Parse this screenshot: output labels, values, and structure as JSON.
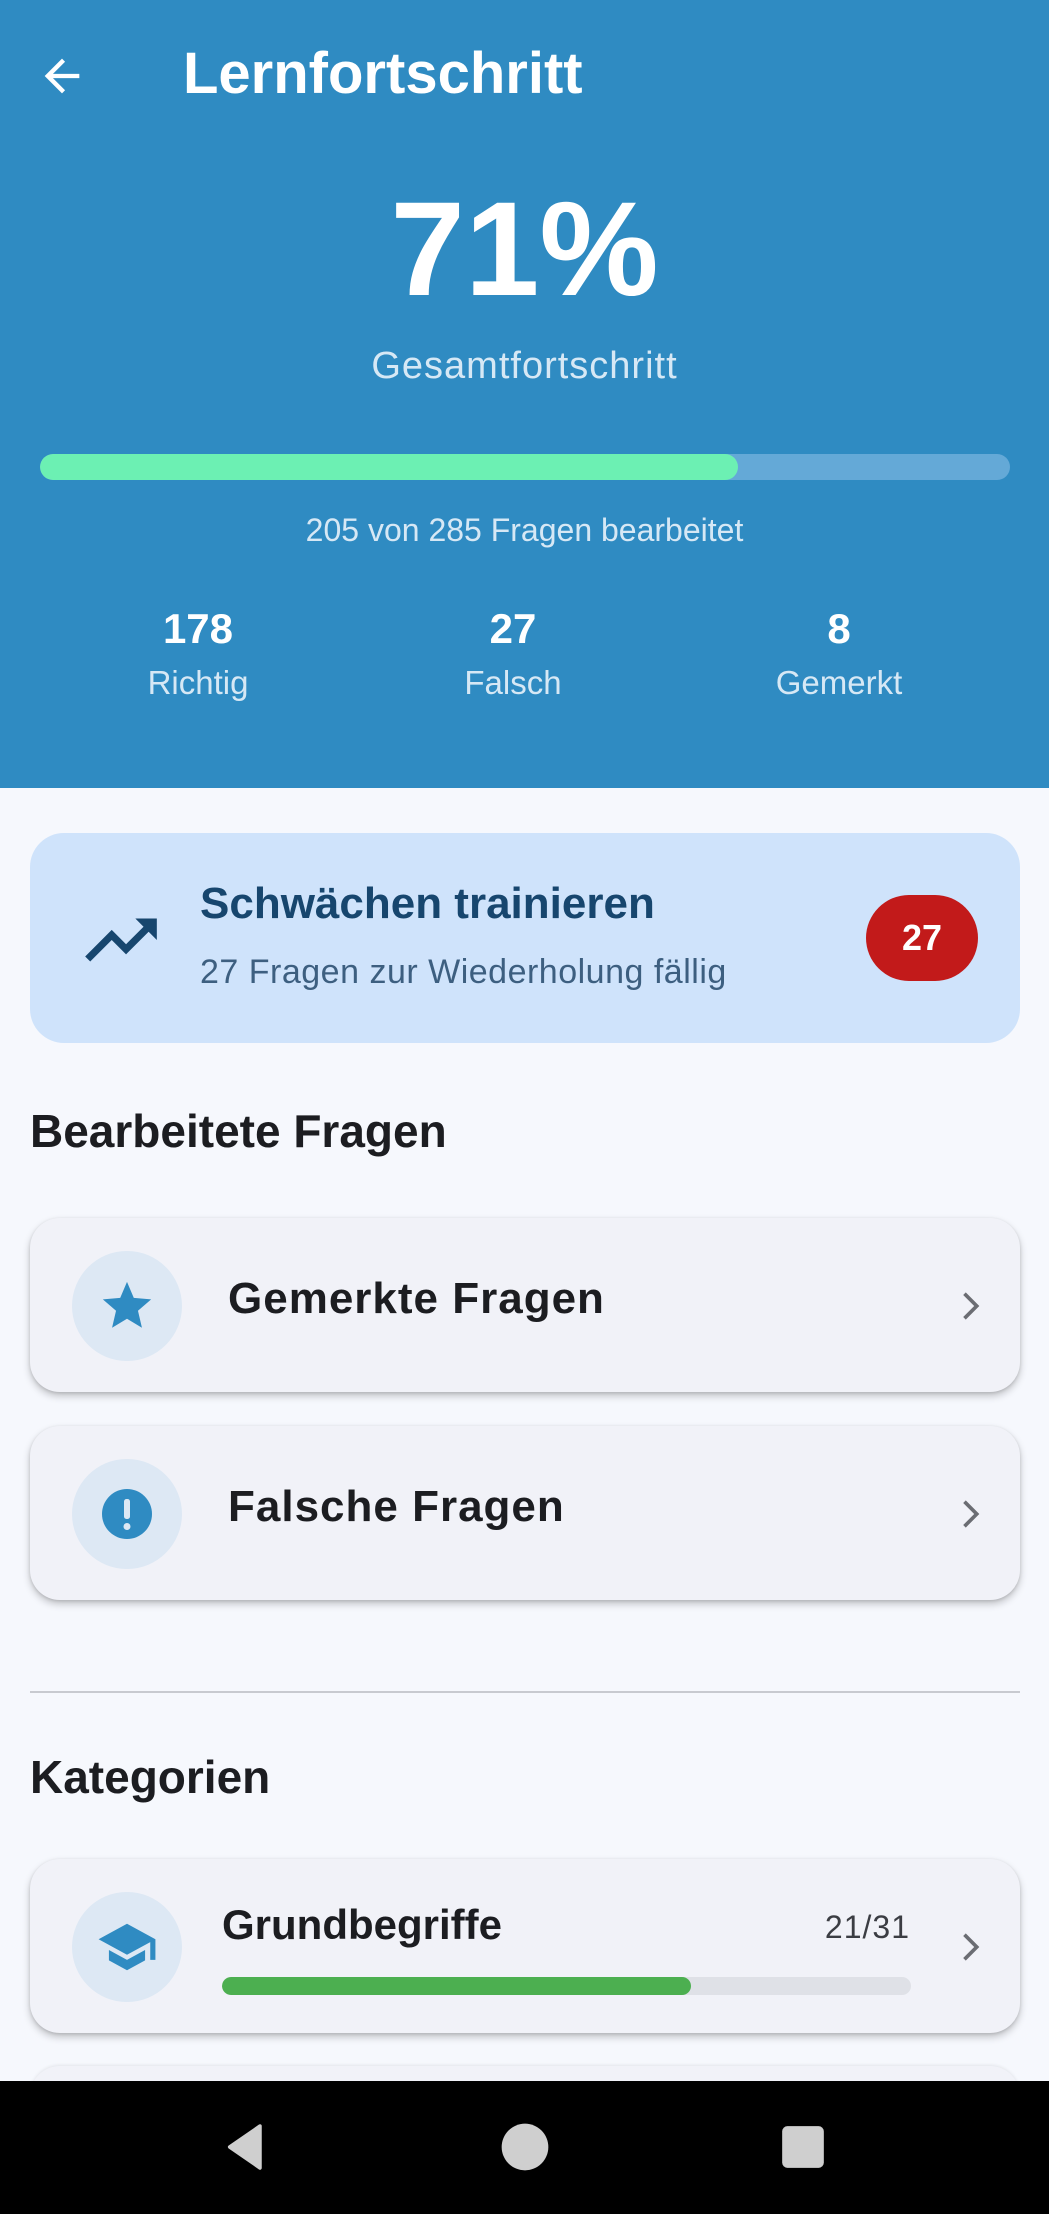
{
  "header": {
    "title": "Lernfortschritt",
    "percent": "71%",
    "overall_label": "Gesamtfortschritt",
    "progress_fraction": 0.72,
    "progress_caption": "205 von 285 Fragen bearbeitet",
    "stats": [
      {
        "value": "178",
        "label": "Richtig"
      },
      {
        "value": "27",
        "label": "Falsch"
      },
      {
        "value": "8",
        "label": "Gemerkt"
      }
    ]
  },
  "weak_training": {
    "icon": "trending-up-icon",
    "title": "Schwächen trainieren",
    "subtitle": "27 Fragen zur Wiederholung fällig",
    "badge": "27"
  },
  "answered_section": {
    "title": "Bearbeitete Fragen",
    "items": [
      {
        "icon": "star-icon",
        "label": "Gemerkte Fragen"
      },
      {
        "icon": "exclamation-icon",
        "label": "Falsche Fragen"
      }
    ]
  },
  "categories_section": {
    "title": "Kategorien",
    "items": [
      {
        "icon": "graduation-cap-icon",
        "name": "Grundbegriffe",
        "count": "21/31",
        "progress_fraction": 0.68
      }
    ]
  },
  "colors": {
    "header_bg": "#2f8bc2",
    "progress_fill": "#6cf0b3",
    "badge_red": "#c21a1a",
    "category_fill": "#4caf50",
    "weak_card_bg": "#cfe3fb"
  },
  "navbar": {
    "icons": [
      "back-triangle-icon",
      "home-circle-icon",
      "recents-square-icon"
    ]
  }
}
